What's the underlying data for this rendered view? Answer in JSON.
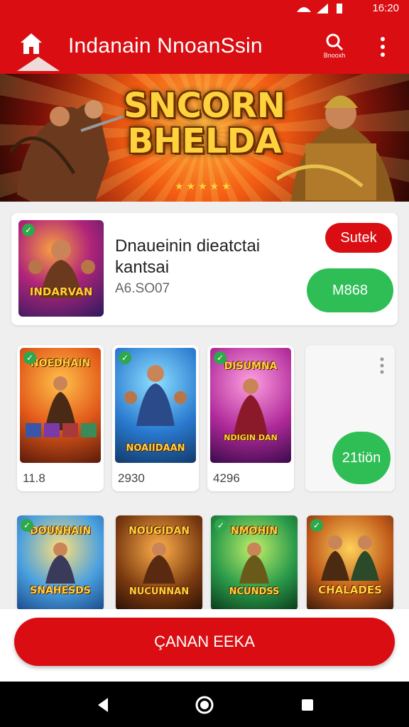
{
  "colors": {
    "brand_red": "#d90d12",
    "action_green": "#2fbe55",
    "verified_green": "#2ea84b"
  },
  "status_bar": {
    "time": "16:20"
  },
  "app_bar": {
    "title": "Indanain NnoanSsin",
    "search_label": "Bnooxh"
  },
  "banner": {
    "title_line1": "SNCORN",
    "title_line2": "BHELDA",
    "stars": "★★★★★"
  },
  "featured": {
    "thumb_title": "INDARVAN",
    "title": "Dnaueinin dieatctai kantsai",
    "subtitle": "A6.SO07",
    "badge_button": "Sutek",
    "action_button": "M868"
  },
  "grid_row1": [
    {
      "art_title": "NOEDHAIN",
      "value": "11.8"
    },
    {
      "art_title": "NOAIIDAAN",
      "value": "2930"
    },
    {
      "art_title": "DISUMNA",
      "art_subtitle": "NDIGIN DAN",
      "value": "4296"
    }
  ],
  "more_card": {
    "button": "21tiön"
  },
  "grid_row2": [
    {
      "art_title": "DOUNHAIN",
      "art_bottom": "SNAHESDS"
    },
    {
      "art_title": "NOUGIDAN",
      "art_bottom": "NUCUNNAN"
    },
    {
      "art_title": "NMOHIN",
      "art_bottom": "NCUNDSS"
    },
    {
      "art_title": "",
      "art_bottom": "CHALADES"
    }
  ],
  "cta": {
    "label": "ÇANAN EEKA"
  },
  "icons": [
    "home-icon",
    "search-icon",
    "more-vert-icon",
    "check-icon",
    "back-icon",
    "home-nav-icon",
    "recents-icon"
  ]
}
